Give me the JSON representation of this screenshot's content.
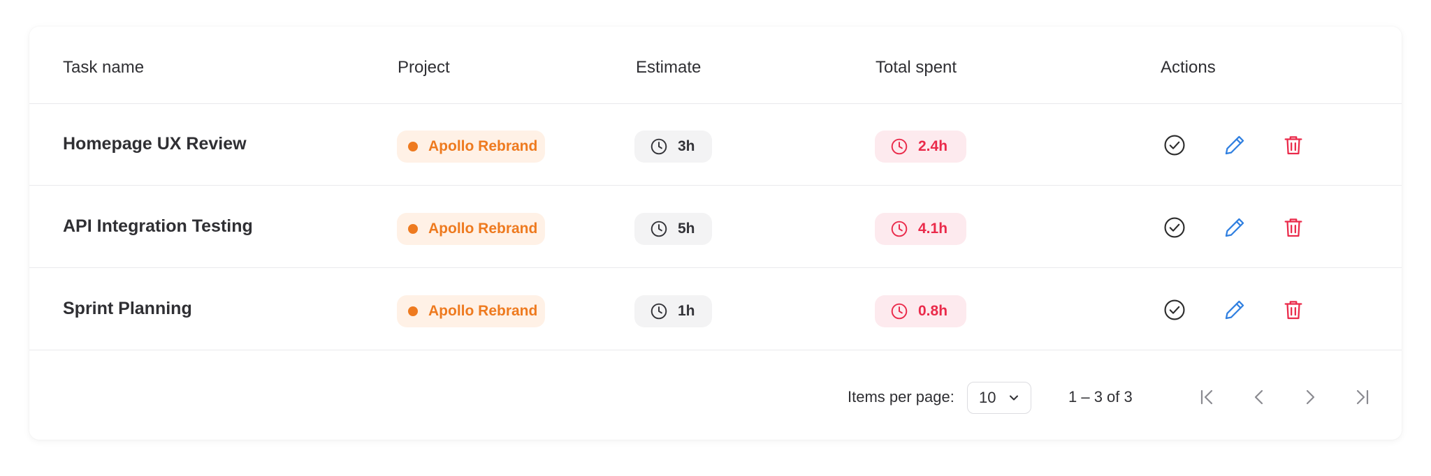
{
  "table": {
    "columns": [
      "Task name",
      "Project",
      "Estimate",
      "Total spent",
      "Actions"
    ],
    "rows": [
      {
        "task": "Homepage UX Review",
        "project": "Apollo Rebrand",
        "estimate": "3h",
        "spent": "2.4h"
      },
      {
        "task": "API Integration Testing",
        "project": "Apollo Rebrand",
        "estimate": "5h",
        "spent": "4.1h"
      },
      {
        "task": "Sprint Planning",
        "project": "Apollo Rebrand",
        "estimate": "1h",
        "spent": "0.8h"
      }
    ]
  },
  "pagination": {
    "items_per_page_label": "Items per page:",
    "items_per_page_value": "10",
    "range_text": "1 – 3 of 3"
  },
  "icons": {
    "project_dot": "dot-icon",
    "estimate": "clock-icon",
    "spent": "clock-icon",
    "actions": [
      "check-circle-icon",
      "pencil-icon",
      "trash-icon"
    ],
    "pager": [
      "first-page-icon",
      "prev-page-icon",
      "next-page-icon",
      "last-page-icon"
    ],
    "select": "chevron-down-icon"
  },
  "colors": {
    "project_text": "#ee7a1f",
    "project_bg": "#fff1e6",
    "estimate_bg": "#f3f3f4",
    "spent_text": "#ea2a4a",
    "spent_bg": "#fdeaee",
    "edit_icon": "#2f7fe0",
    "delete_icon": "#ea2a4a"
  }
}
